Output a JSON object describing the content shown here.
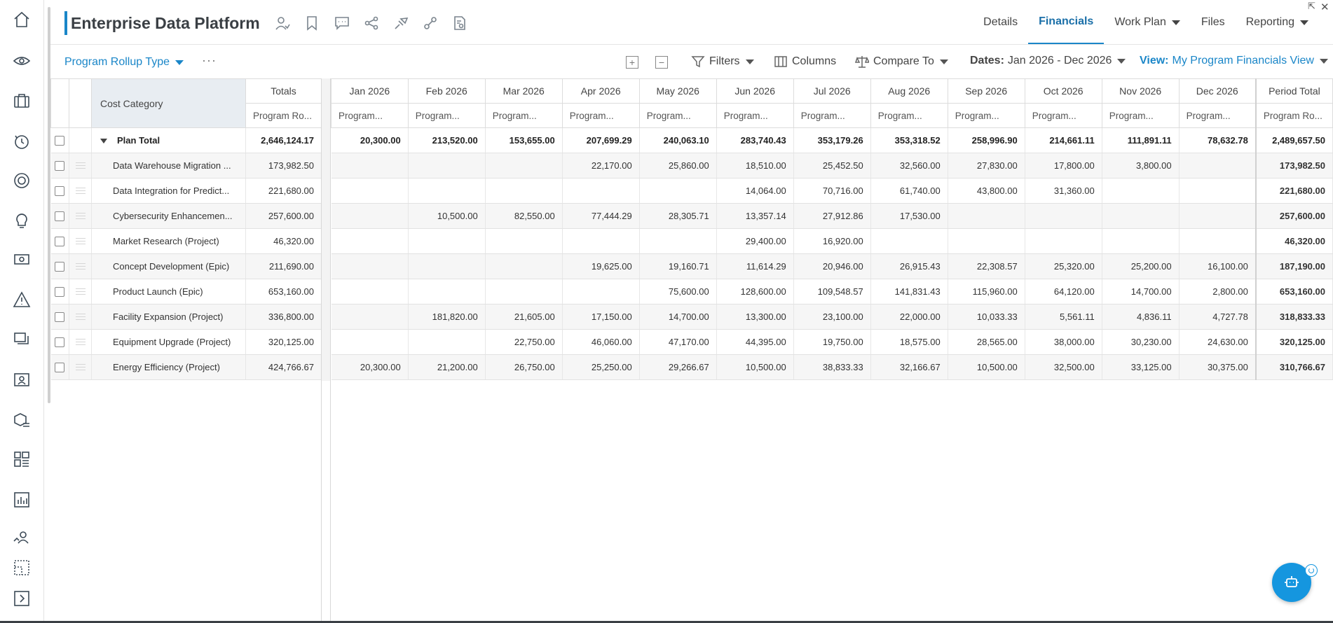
{
  "app": {
    "title": "Enterprise Data Platform"
  },
  "nav_tabs": [
    {
      "label": "Details"
    },
    {
      "label": "Financials"
    },
    {
      "label": "Work Plan"
    },
    {
      "label": "Files"
    },
    {
      "label": "Reporting"
    }
  ],
  "toolbar": {
    "rollup_label": "Program Rollup Type",
    "more_label": "···",
    "filters_label": "Filters",
    "columns_label": "Columns",
    "compare_label": "Compare To",
    "dates_label": "Dates:",
    "dates_value": "Jan 2026 - Dec 2026",
    "view_label": "View:",
    "view_value": "My Program Financials View"
  },
  "left_table": {
    "category_header": "Cost Category",
    "totals_header": "Totals",
    "totals_subheader": "Program Ro...",
    "total_row": {
      "name": "Plan Total",
      "total": "2,646,124.17"
    },
    "rows": [
      {
        "name": "Data Warehouse Migration ...",
        "total": "173,982.50"
      },
      {
        "name": "Data Integration for Predict...",
        "total": "221,680.00"
      },
      {
        "name": "Cybersecurity Enhancemen...",
        "total": "257,600.00"
      },
      {
        "name": "Market Research (Project)",
        "total": "46,320.00"
      },
      {
        "name": "Concept Development (Epic)",
        "total": "211,690.00"
      },
      {
        "name": "Product Launch (Epic)",
        "total": "653,160.00"
      },
      {
        "name": "Facility Expansion (Project)",
        "total": "336,800.00"
      },
      {
        "name": "Equipment Upgrade (Project)",
        "total": "320,125.00"
      },
      {
        "name": "Energy Efficiency (Project)",
        "total": "424,766.67"
      }
    ]
  },
  "right_table": {
    "months": [
      "Jan 2026",
      "Feb 2026",
      "Mar 2026",
      "Apr 2026",
      "May 2026",
      "Jun 2026",
      "Jul 2026",
      "Aug 2026",
      "Sep 2026",
      "Oct 2026",
      "Nov 2026",
      "Dec 2026"
    ],
    "month_subheader": "Program...",
    "period_header": "Period Total",
    "period_subheader": "Program Ro...",
    "total_row": [
      "20,300.00",
      "213,520.00",
      "153,655.00",
      "207,699.29",
      "240,063.10",
      "283,740.43",
      "353,179.26",
      "353,318.52",
      "258,996.90",
      "214,661.11",
      "111,891.11",
      "78,632.78",
      "2,489,657.50"
    ],
    "rows": [
      [
        "",
        "",
        "",
        "22,170.00",
        "25,860.00",
        "18,510.00",
        "25,452.50",
        "32,560.00",
        "27,830.00",
        "17,800.00",
        "3,800.00",
        "",
        "173,982.50"
      ],
      [
        "",
        "",
        "",
        "",
        "",
        "14,064.00",
        "70,716.00",
        "61,740.00",
        "43,800.00",
        "31,360.00",
        "",
        "",
        "221,680.00"
      ],
      [
        "",
        "10,500.00",
        "82,550.00",
        "77,444.29",
        "28,305.71",
        "13,357.14",
        "27,912.86",
        "17,530.00",
        "",
        "",
        "",
        "",
        "257,600.00"
      ],
      [
        "",
        "",
        "",
        "",
        "",
        "29,400.00",
        "16,920.00",
        "",
        "",
        "",
        "",
        "",
        "46,320.00"
      ],
      [
        "",
        "",
        "",
        "19,625.00",
        "19,160.71",
        "11,614.29",
        "20,946.00",
        "26,915.43",
        "22,308.57",
        "25,320.00",
        "25,200.00",
        "16,100.00",
        "187,190.00"
      ],
      [
        "",
        "",
        "",
        "",
        "75,600.00",
        "128,600.00",
        "109,548.57",
        "141,831.43",
        "115,960.00",
        "64,120.00",
        "14,700.00",
        "2,800.00",
        "653,160.00"
      ],
      [
        "",
        "181,820.00",
        "21,605.00",
        "17,150.00",
        "14,700.00",
        "13,300.00",
        "23,100.00",
        "22,000.00",
        "10,033.33",
        "5,561.11",
        "4,836.11",
        "4,727.78",
        "318,833.33"
      ],
      [
        "",
        "",
        "22,750.00",
        "46,060.00",
        "47,170.00",
        "44,395.00",
        "19,750.00",
        "18,575.00",
        "28,565.00",
        "38,000.00",
        "30,230.00",
        "24,630.00",
        "320,125.00"
      ],
      [
        "20,300.00",
        "21,200.00",
        "26,750.00",
        "25,250.00",
        "29,266.67",
        "10,500.00",
        "38,833.33",
        "32,166.67",
        "10,500.00",
        "32,500.00",
        "33,125.00",
        "30,375.00",
        "310,766.67"
      ]
    ]
  },
  "colors": {
    "accent": "#1a86c8",
    "assistant_button": "#1596df"
  }
}
